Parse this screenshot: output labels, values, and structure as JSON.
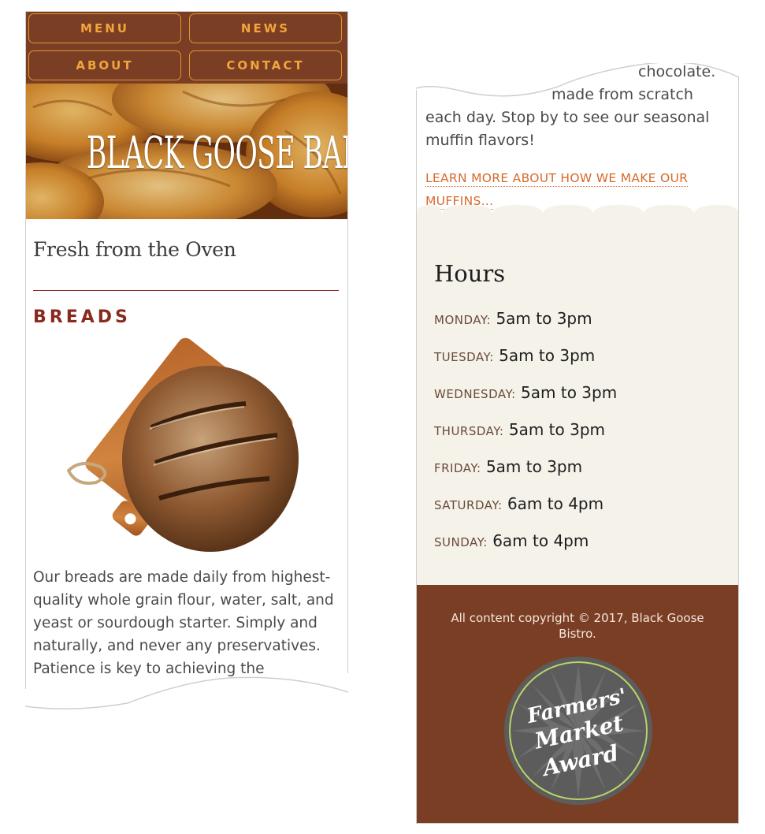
{
  "nav": {
    "items": [
      {
        "label": "MENU"
      },
      {
        "label": "NEWS"
      },
      {
        "label": "ABOUT"
      },
      {
        "label": "CONTACT"
      }
    ]
  },
  "hero": {
    "title": "BLACK GOOSE BAKERY"
  },
  "main": {
    "heading": "Fresh from the Oven",
    "section_title": "BREADS",
    "breads_text": "Our breads are made daily from highest-quality whole grain flour, water, salt, and yeast or sourdough starter. Simply and naturally, and never any preservatives. Patience is key to achieving the"
  },
  "muffins": {
    "partial_top": "chocolate.",
    "text": "made from scratch each day. Stop by to see our seasonal muffin flavors!",
    "link": "LEARN MORE ABOUT HOW WE MAKE OUR MUFFINS..."
  },
  "hours": {
    "title": "Hours",
    "rows": [
      {
        "day": "MONDAY:",
        "time": "5am to 3pm"
      },
      {
        "day": "TUESDAY:",
        "time": "5am to 3pm"
      },
      {
        "day": "WEDNESDAY:",
        "time": "5am to 3pm"
      },
      {
        "day": "THURSDAY:",
        "time": "5am to 3pm"
      },
      {
        "day": "FRIDAY:",
        "time": "5am to 3pm"
      },
      {
        "day": "SATURDAY:",
        "time": "6am to 4pm"
      },
      {
        "day": "SUNDAY:",
        "time": "6am to 4pm"
      }
    ]
  },
  "footer": {
    "copyright": "All content copyright © 2017, Black Goose Bistro.",
    "award": {
      "line1": "Farmers'",
      "line2": "Market",
      "line3": "Award"
    }
  },
  "colors": {
    "brand_brown": "#7a3e24",
    "nav_orange": "#f2a53b",
    "link_orange": "#d8692c",
    "heading_red": "#8a2a1e",
    "panel_cream": "#f5f2ea",
    "award_green": "#b9d36a"
  }
}
